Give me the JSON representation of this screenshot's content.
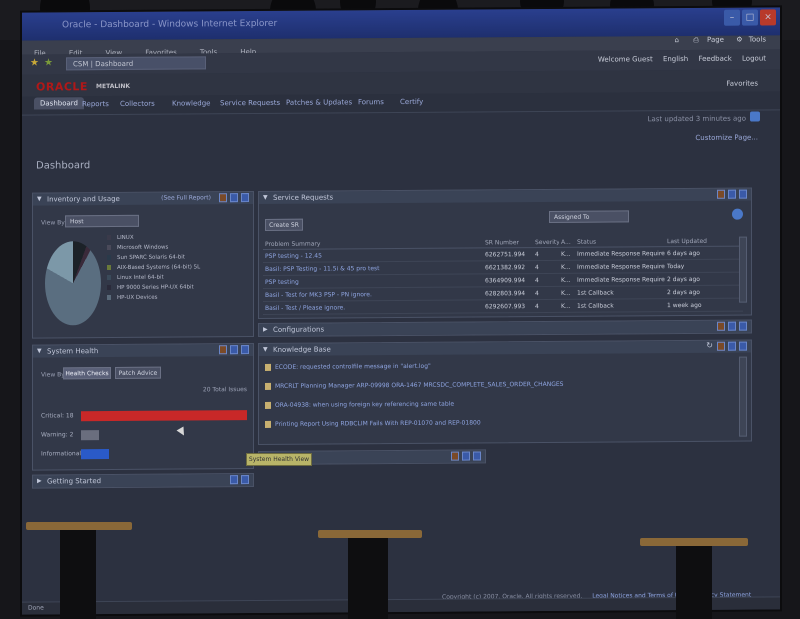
{
  "window": {
    "title": "Oracle - Dashboard - Windows Internet Explorer",
    "controls": [
      "minimize",
      "maximize",
      "close"
    ]
  },
  "menu": {
    "items": [
      "File",
      "Edit",
      "View",
      "Favorites",
      "Tools",
      "Help"
    ]
  },
  "toolbar": {
    "page_label": "Page",
    "tools_label": "Tools"
  },
  "address": {
    "url": "CSM | Dashboard"
  },
  "header": {
    "welcome": "Welcome  Guest",
    "language": "English",
    "feedback": "Feedback",
    "logout": "Logout",
    "favorites": "Favorites"
  },
  "brand": {
    "logo": "ORACLE",
    "product": "METALINK"
  },
  "nav": {
    "tabs": [
      "Dashboard",
      "Reports",
      "Collectors"
    ],
    "links": [
      "Knowledge",
      "Service Requests",
      "Patches & Updates",
      "Forums",
      "Certify"
    ]
  },
  "page": {
    "last_updated": "Last updated 3 minutes ago",
    "customize": "Customize Page...",
    "title": "Dashboard"
  },
  "inventory": {
    "title": "Inventory and Usage",
    "full_report": "(See Full Report)",
    "view_by_label": "View By",
    "view_by_value": "Host",
    "legend": [
      {
        "label": "LINUX",
        "color": "#3a3a4a"
      },
      {
        "label": "Microsoft Windows",
        "color": "#4a4a5a"
      },
      {
        "label": "Sun SPARC Solaris 64-bit",
        "color": "#2a3a4a"
      },
      {
        "label": "AIX-Based Systems (64-bit) 5L",
        "color": "#6a7a3a"
      },
      {
        "label": "Linux Intel 64-bit",
        "color": "#3a4a5a"
      },
      {
        "label": "HP 9000 Series HP-UX 64bit",
        "color": "#2a2a3a"
      },
      {
        "label": "HP-UX Devices",
        "color": "#5a6a7a"
      }
    ]
  },
  "health": {
    "title": "System Health",
    "view_by_label": "View By",
    "tab_health": "Health Checks",
    "tab_patch": "Patch Advice",
    "total": "20 Total Issues",
    "rows": [
      {
        "label": "Critical: 18",
        "value": 18,
        "color": "#c82828"
      },
      {
        "label": "Warning: 2",
        "value": 2,
        "color": "#6a6e7e"
      },
      {
        "label": "Informational: 3",
        "value": 3,
        "color": "#2a5ac8"
      }
    ],
    "tooltip": "System Health View"
  },
  "getting_started": {
    "title": "Getting Started"
  },
  "service_requests": {
    "title": "Service Requests",
    "create_btn": "Create SR",
    "filter": "Assigned To",
    "columns": [
      "Problem Summary",
      "SR Number",
      "Severity",
      "A...",
      "Status",
      "Last Updated"
    ],
    "rows": [
      [
        "PSP testing - 12.45",
        "6262751.994",
        "4",
        "K...",
        "Immediate Response Required",
        "6 days ago"
      ],
      [
        "Basil: PSP Testing - 11.5i & 45 pro test",
        "6621382.992",
        "4",
        "K...",
        "Immediate Response Required",
        "Today"
      ],
      [
        "PSP testing",
        "6364909.994",
        "4",
        "K...",
        "Immediate Response Required",
        "2 days ago"
      ],
      [
        "Basil - Test for MK3 PSP - PN ignore.",
        "6282803.994",
        "4",
        "K...",
        "1st Callback",
        "2 days ago"
      ],
      [
        "Basil - Test / Please ignore.",
        "6292607.993",
        "4",
        "K...",
        "1st Callback",
        "1 week ago"
      ]
    ]
  },
  "configurations": {
    "title": "Configurations"
  },
  "knowledge": {
    "title": "Knowledge Base",
    "items": [
      "ECODE: requested controlfile message in \"alert.log\"",
      "MRCRLT Planning Manager ARP-09998 ORA-1467 MRCSDC_COMPLETE_SALES_ORDER_CHANGES",
      "ORA-04938: when using foreign key referencing same table",
      "Printing Report Using RDBCLIM Fails With REP-01070 and REP-01800"
    ]
  },
  "footer": {
    "copyright": "Copyright (c) 2007, Oracle. All rights reserved.",
    "legal": "Legal Notices and Terms of Use",
    "privacy": "Privacy Statement"
  },
  "status": {
    "text": "Done"
  }
}
